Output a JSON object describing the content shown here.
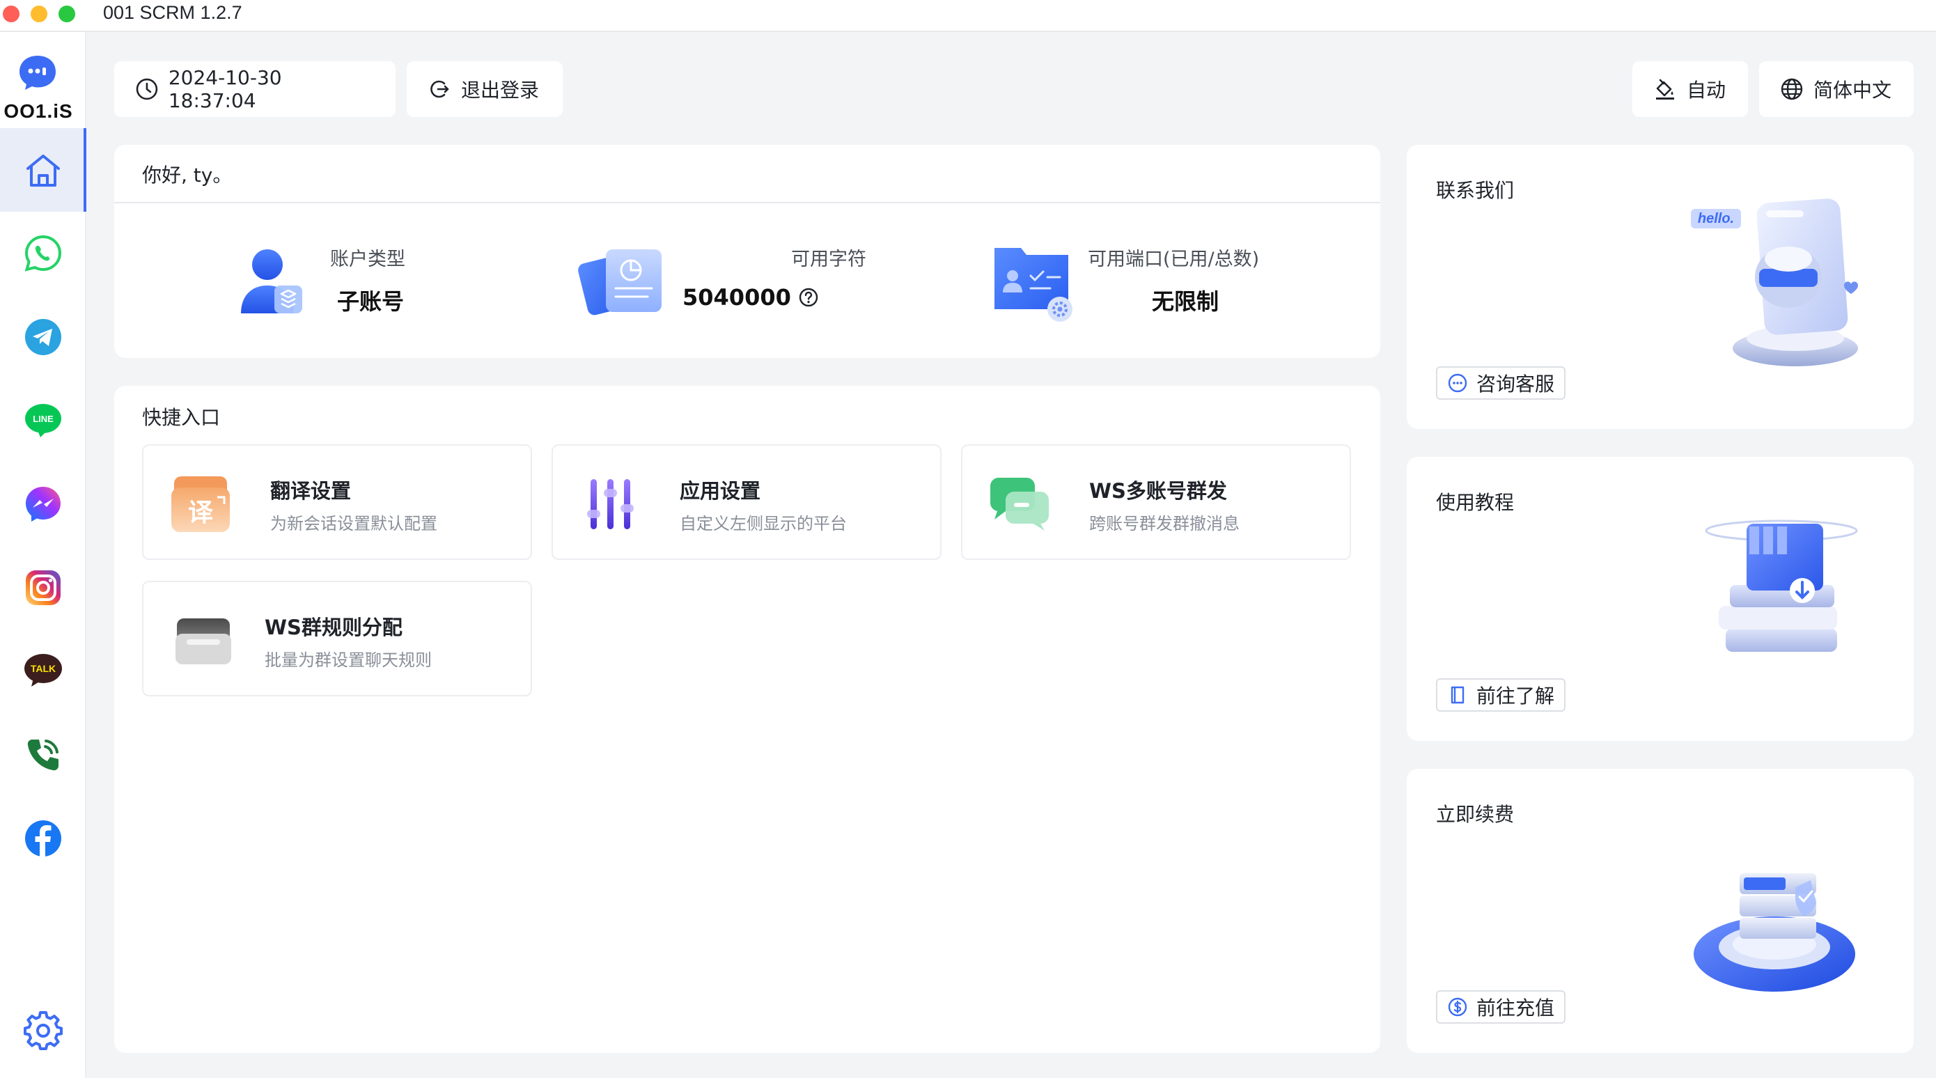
{
  "window": {
    "title": "001 SCRM 1.2.7"
  },
  "logo": {
    "text": "OO1.iS"
  },
  "sidebar": {
    "items": [
      {
        "icon": "home-icon",
        "active": true
      },
      {
        "icon": "whatsapp-icon"
      },
      {
        "icon": "telegram-icon"
      },
      {
        "icon": "line-icon",
        "label": "LINE"
      },
      {
        "icon": "messenger-icon"
      },
      {
        "icon": "instagram-icon"
      },
      {
        "icon": "kakaotalk-icon",
        "label": "TALK"
      },
      {
        "icon": "phone-icon"
      },
      {
        "icon": "facebook-icon"
      }
    ],
    "settings_icon": "gear-icon"
  },
  "header": {
    "datetime": "2024-10-30 18:37:04",
    "logout_label": "退出登录",
    "theme_label": "自动",
    "language_label": "简体中文"
  },
  "greeting": {
    "text": "你好, ty。",
    "stats": [
      {
        "label": "账户类型",
        "value": "子账号"
      },
      {
        "label": "可用字符",
        "value": "5040000"
      },
      {
        "label": "可用端口(已用/总数)",
        "value": "无限制"
      }
    ]
  },
  "quick": {
    "title": "快捷入口",
    "entries": [
      {
        "title": "翻译设置",
        "desc": "为新会话设置默认配置",
        "icon_glyph": "译"
      },
      {
        "title": "应用设置",
        "desc": "自定义左侧显示的平台"
      },
      {
        "title": "WS多账号群发",
        "desc": "跨账号群发群撤消息"
      },
      {
        "title": "WS群规则分配",
        "desc": "批量为群设置聊天规则"
      }
    ]
  },
  "side_cards": [
    {
      "title": "联系我们",
      "button": "咨询客服",
      "illus_text": "hello."
    },
    {
      "title": "使用教程",
      "button": "前往了解"
    },
    {
      "title": "立即续费",
      "button": "前往充值"
    }
  ],
  "colors": {
    "accent": "#3d6cf4",
    "background": "#f3f4f6",
    "whatsapp": "#25d366",
    "telegram": "#2aa3e0",
    "line": "#06c755",
    "facebook": "#1877f2",
    "kakao": "#3c1e1e"
  }
}
